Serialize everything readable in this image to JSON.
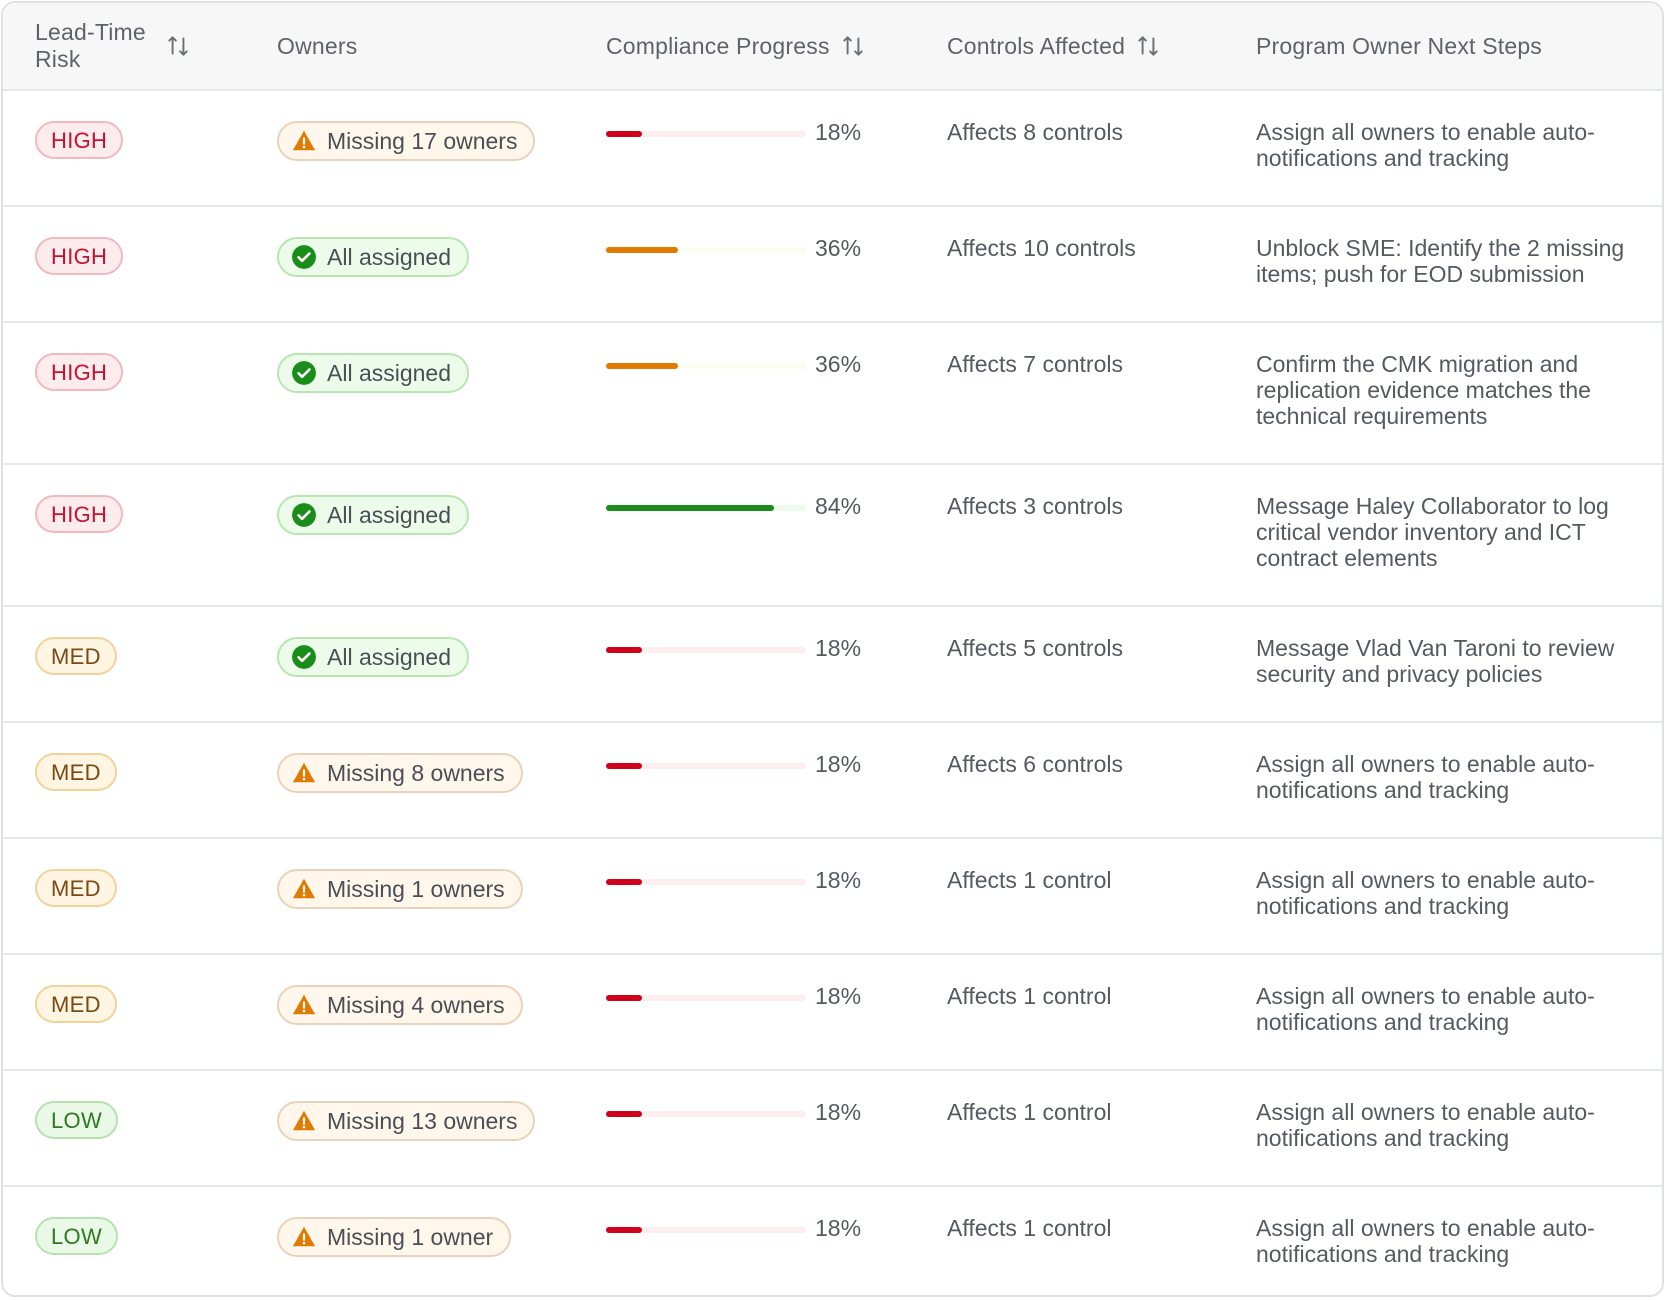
{
  "columns": {
    "risk": "Lead-Time Risk",
    "owners": "Owners",
    "progress": "Compliance Progress",
    "controls": "Controls Affected",
    "next_steps": "Program Owner Next Steps"
  },
  "colors": {
    "high": "#c8102e",
    "med": "#7a4a10",
    "low": "#2d7a1f",
    "bar_red": "#d0021b",
    "bar_orange": "#e07b00",
    "bar_green": "#1a8c1a",
    "warning": "#e07b00",
    "check": "#1a8c1a"
  },
  "rows": [
    {
      "risk": "HIGH",
      "risk_level": "high",
      "owners": "Missing 17 owners",
      "owner_status": "missing",
      "progress": 18,
      "progress_label": "18%",
      "controls": "Affects 8 controls",
      "next": "Assign all owners to enable auto-notifications and tracking"
    },
    {
      "risk": "HIGH",
      "risk_level": "high",
      "owners": "All assigned",
      "owner_status": "ok",
      "progress": 36,
      "progress_label": "36%",
      "controls": "Affects 10 controls",
      "next": "Unblock SME: Identify the 2 missing items; push for EOD submission"
    },
    {
      "risk": "HIGH",
      "risk_level": "high",
      "owners": "All assigned",
      "owner_status": "ok",
      "progress": 36,
      "progress_label": "36%",
      "controls": "Affects 7 controls",
      "next": "Confirm the CMK migration and replication evidence matches the technical requirements"
    },
    {
      "risk": "HIGH",
      "risk_level": "high",
      "owners": "All assigned",
      "owner_status": "ok",
      "progress": 84,
      "progress_label": "84%",
      "controls": "Affects 3 controls",
      "next": "Message Haley Collaborator to log critical vendor inventory and ICT contract elements"
    },
    {
      "risk": "MED",
      "risk_level": "med",
      "owners": "All assigned",
      "owner_status": "ok",
      "progress": 18,
      "progress_label": "18%",
      "controls": "Affects 5 controls",
      "next": "Message Vlad Van Taroni to review security and privacy policies"
    },
    {
      "risk": "MED",
      "risk_level": "med",
      "owners": "Missing 8 owners",
      "owner_status": "missing",
      "progress": 18,
      "progress_label": "18%",
      "controls": "Affects 6 controls",
      "next": "Assign all owners to enable auto-notifications and tracking"
    },
    {
      "risk": "MED",
      "risk_level": "med",
      "owners": "Missing 1 owners",
      "owner_status": "missing",
      "progress": 18,
      "progress_label": "18%",
      "controls": "Affects 1 control",
      "next": "Assign all owners to enable auto-notifications and tracking"
    },
    {
      "risk": "MED",
      "risk_level": "med",
      "owners": "Missing 4 owners",
      "owner_status": "missing",
      "progress": 18,
      "progress_label": "18%",
      "controls": "Affects 1 control",
      "next": "Assign all owners to enable auto-notifications and tracking"
    },
    {
      "risk": "LOW",
      "risk_level": "low",
      "owners": "Missing 13 owners",
      "owner_status": "missing",
      "progress": 18,
      "progress_label": "18%",
      "controls": "Affects 1 control",
      "next": "Assign all owners to enable auto-notifications and tracking"
    },
    {
      "risk": "LOW",
      "risk_level": "low",
      "owners": "Missing 1 owner",
      "owner_status": "missing",
      "progress": 18,
      "progress_label": "18%",
      "controls": "Affects 1 control",
      "next": "Assign all owners to enable auto-notifications and tracking"
    }
  ]
}
